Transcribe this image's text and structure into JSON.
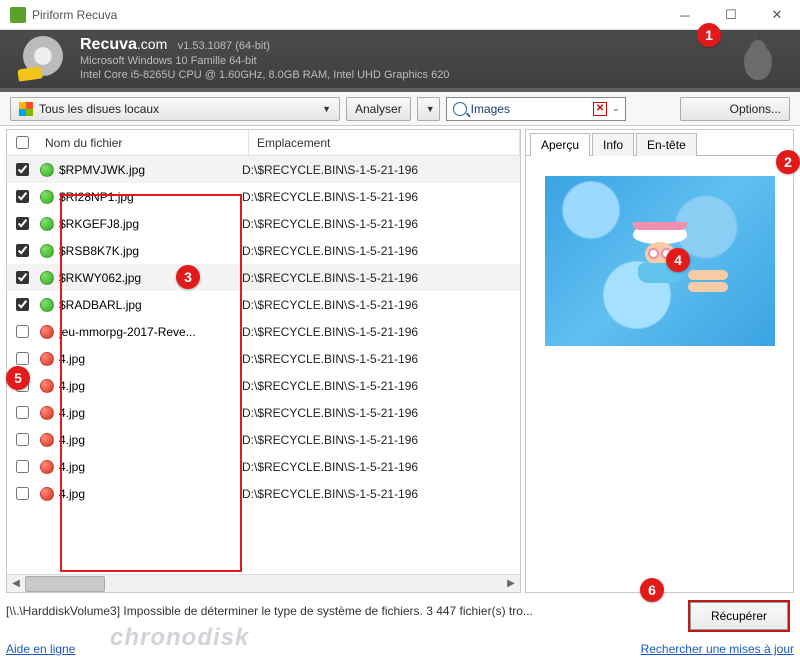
{
  "window": {
    "title": "Piriform Recuva"
  },
  "header": {
    "brand": "Recuva",
    "brand_domain": ".com",
    "version": "v1.53.1087 (64-bit)",
    "os_line": "Microsoft Windows 10 Famille 64-bit",
    "hw_line": "Intel Core i5-8265U CPU @ 1.60GHz, 8.0GB RAM, Intel UHD Graphics 620"
  },
  "toolbar": {
    "drive_label": "Tous les disues locaux",
    "analyze_label": "Analyser",
    "filter_value": "Images",
    "options_label": "Options..."
  },
  "columns": {
    "name": "Nom du fichier",
    "location": "Emplacement"
  },
  "rows": [
    {
      "checked": true,
      "status": "green",
      "name": "$RPMVJWK.jpg",
      "location": "D:\\$RECYCLE.BIN\\S-1-5-21-196",
      "selected": true
    },
    {
      "checked": true,
      "status": "green",
      "name": "$RI28NP1.jpg",
      "location": "D:\\$RECYCLE.BIN\\S-1-5-21-196",
      "selected": false
    },
    {
      "checked": true,
      "status": "green",
      "name": "$RKGEFJ8.jpg",
      "location": "D:\\$RECYCLE.BIN\\S-1-5-21-196",
      "selected": false
    },
    {
      "checked": true,
      "status": "green",
      "name": "$RSB8K7K.jpg",
      "location": "D:\\$RECYCLE.BIN\\S-1-5-21-196",
      "selected": false
    },
    {
      "checked": true,
      "status": "green",
      "name": "$RKWY062.jpg",
      "location": "D:\\$RECYCLE.BIN\\S-1-5-21-196",
      "selected": true
    },
    {
      "checked": true,
      "status": "green",
      "name": "$RADBARL.jpg",
      "location": "D:\\$RECYCLE.BIN\\S-1-5-21-196",
      "selected": false
    },
    {
      "checked": false,
      "status": "red",
      "name": "jeu-mmorpg-2017-Reve...",
      "location": "D:\\$RECYCLE.BIN\\S-1-5-21-196",
      "selected": false
    },
    {
      "checked": false,
      "status": "red",
      "name": "4.jpg",
      "location": "D:\\$RECYCLE.BIN\\S-1-5-21-196",
      "selected": false
    },
    {
      "checked": false,
      "status": "red",
      "name": "4.jpg",
      "location": "D:\\$RECYCLE.BIN\\S-1-5-21-196",
      "selected": false
    },
    {
      "checked": false,
      "status": "red",
      "name": "4.jpg",
      "location": "D:\\$RECYCLE.BIN\\S-1-5-21-196",
      "selected": false
    },
    {
      "checked": false,
      "status": "red",
      "name": "4.jpg",
      "location": "D:\\$RECYCLE.BIN\\S-1-5-21-196",
      "selected": false
    },
    {
      "checked": false,
      "status": "red",
      "name": "4.jpg",
      "location": "D:\\$RECYCLE.BIN\\S-1-5-21-196",
      "selected": false
    },
    {
      "checked": false,
      "status": "red",
      "name": "4.jpg",
      "location": "D:\\$RECYCLE.BIN\\S-1-5-21-196",
      "selected": false
    }
  ],
  "tabs": {
    "preview": "Aperçu",
    "info": "Info",
    "header": "En-tête"
  },
  "status": "[\\\\.\\HarddiskVolume3] Impossible de déterminer le type de système de fichiers. 3 447 fichier(s) tro...",
  "recover_label": "Récupérer",
  "footer": {
    "help": "Aide en ligne",
    "update": "Rechercher une mises à jour"
  },
  "watermark": "chronodisk",
  "markers": {
    "1": "1",
    "2": "2",
    "3": "3",
    "4": "4",
    "5": "5",
    "6": "6"
  }
}
